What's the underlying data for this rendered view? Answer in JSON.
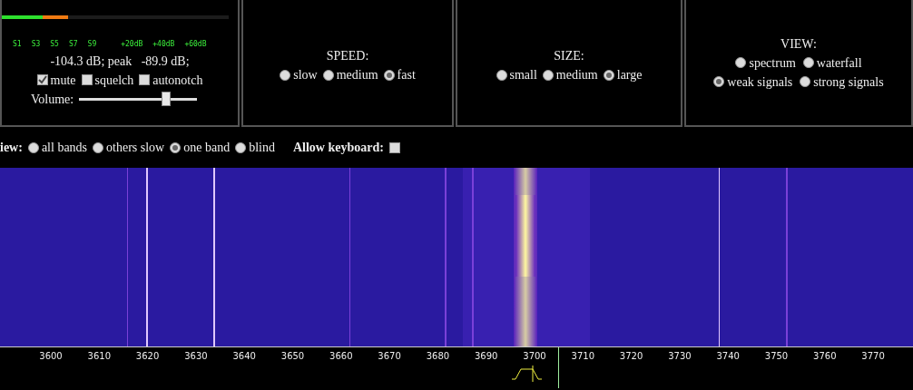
{
  "smeter": {
    "level": 0.29,
    "scale": [
      "S1",
      "S3",
      "S5",
      "S7",
      "S9",
      "+20dB",
      "+40dB",
      "+60dB"
    ],
    "reading": "-104.3 dB; peak   -89.9 dB;"
  },
  "audio": {
    "checkboxes": [
      {
        "label": "mute",
        "checked": true
      },
      {
        "label": "squelch",
        "checked": false
      },
      {
        "label": "autonotch",
        "checked": false
      }
    ],
    "volume": {
      "label": "Volume:",
      "level": 0.74
    }
  },
  "speed": {
    "title": "SPEED:",
    "options": [
      {
        "label": "slow",
        "selected": false
      },
      {
        "label": "medium",
        "selected": false
      },
      {
        "label": "fast",
        "selected": true
      }
    ]
  },
  "size": {
    "title": "SIZE:",
    "options": [
      {
        "label": "small",
        "selected": false
      },
      {
        "label": "medium",
        "selected": false
      },
      {
        "label": "large",
        "selected": true
      }
    ]
  },
  "view": {
    "title": "VIEW:",
    "rows": [
      [
        {
          "label": "spectrum",
          "selected": false
        },
        {
          "label": "waterfall",
          "selected": false
        }
      ],
      [
        {
          "label": "weak signals",
          "selected": true
        },
        {
          "label": "strong signals",
          "selected": false
        }
      ]
    ]
  },
  "band_view": {
    "label": "iew:",
    "options": [
      {
        "label": "all bands",
        "selected": false
      },
      {
        "label": "others slow",
        "selected": false
      },
      {
        "label": "one band",
        "selected": true
      },
      {
        "label": "blind",
        "selected": false
      }
    ],
    "keyboard_label": "Allow keyboard:",
    "keyboard_checked": false
  },
  "frequency_scale": [
    "3600",
    "3610",
    "3620",
    "3630",
    "3640",
    "3650",
    "3660",
    "3670",
    "3680",
    "3690",
    "3700",
    "3710",
    "3720",
    "3730",
    "3740",
    "3750",
    "3760",
    "3770"
  ]
}
